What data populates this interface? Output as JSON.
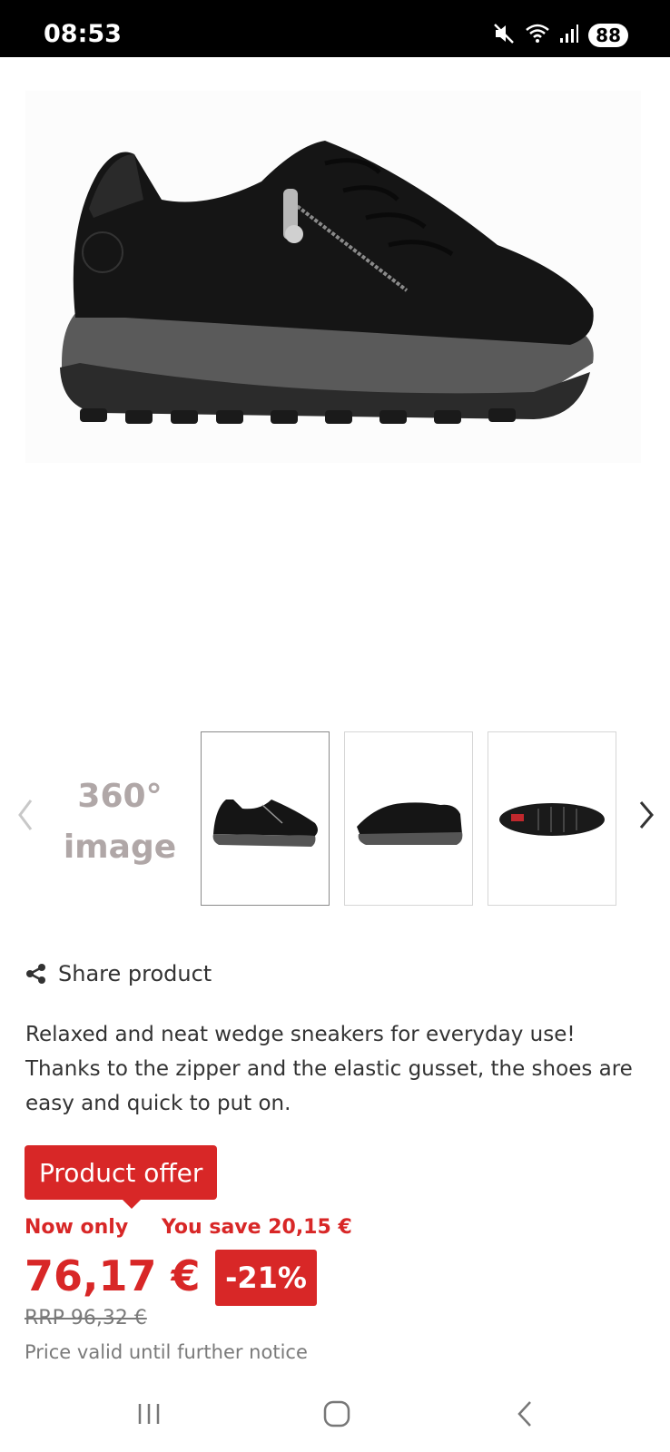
{
  "status_bar": {
    "time": "08:53",
    "battery": "88",
    "icons": [
      "mute-icon",
      "wifi-icon",
      "signal-icon"
    ]
  },
  "product": {
    "hero_image": "black-wedge-sneaker-image"
  },
  "gallery": {
    "label_360_line1": "360°",
    "label_360_line2": "image",
    "thumbnails": [
      {
        "image": "sneaker-side-view",
        "active": true
      },
      {
        "image": "sneaker-other-side-view",
        "active": false
      },
      {
        "image": "sneaker-sole-view",
        "active": false
      }
    ]
  },
  "share": {
    "label": "Share product"
  },
  "description": "Relaxed and neat wedge sneakers for everyday use! Thanks to the zipper and the elastic gusset, the shoes are easy and quick to put on.",
  "offer": {
    "badge": "Product offer",
    "now_only": "Now only",
    "you_save": "You save 20,15 €",
    "price": "76,17 €",
    "discount": "-21%",
    "rrp": "RRP 96,32 €",
    "note": "Price valid until further notice"
  },
  "colors": {
    "accent_red": "#d82727",
    "label_grey": "#b0a7a7"
  }
}
